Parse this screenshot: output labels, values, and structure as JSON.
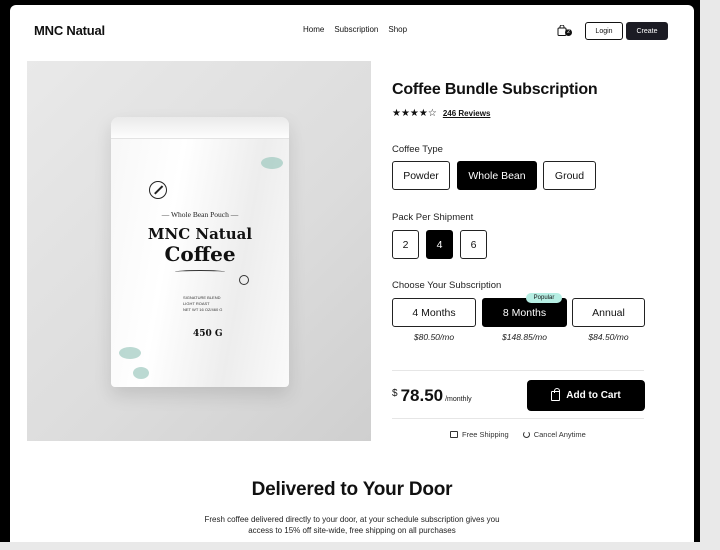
{
  "brand": "MNC Natual",
  "nav": [
    "Home",
    "Subscription",
    "Shop"
  ],
  "cart": {
    "icon": "shopping-bag-icon",
    "count": "2"
  },
  "auth": {
    "login": "Login",
    "create": "Create"
  },
  "pouch": {
    "subtitle": "— Whole Bean Pouch —",
    "brand": "MNC Natual",
    "title": "Coffee",
    "desc_lines": [
      "SIGNATURE BLEND",
      "LIGHT ROAST",
      "NET WT 16 OZ/460 G"
    ],
    "weight": "450 G"
  },
  "product": {
    "title": "Coffee Bundle Subscription",
    "stars": "★★★★☆",
    "reviews": "246 Reviews"
  },
  "coffee_type": {
    "label": "Coffee Type",
    "options": [
      "Powder",
      "Whole Bean",
      "Groud"
    ],
    "selected": "Whole Bean"
  },
  "pack": {
    "label": "Pack Per Shipment",
    "options": [
      "2",
      "4",
      "6"
    ],
    "selected": "4"
  },
  "subscription": {
    "label": "Choose Your  Subscription",
    "options": [
      "4 Months",
      "8 Months",
      "Annual"
    ],
    "prices": [
      "$80.50/mo",
      "$148.85/mo",
      "$84.50/mo"
    ],
    "selected": "8 Months",
    "popular_badge": "Popular"
  },
  "pricing": {
    "currency": "$",
    "amount": "78.50",
    "period": "/monthly"
  },
  "add_to_cart": "Add to Cart",
  "perks": [
    "Free Shipping",
    "Cancel Anytime"
  ],
  "section": {
    "headline": "Delivered to Your Door",
    "line1": "Fresh coffee delivered directly to your door, at your schedule  subscription gives you",
    "line2": "access to 15% off site-wide, free shipping on all purchases"
  },
  "colors": {
    "accent": "#000000",
    "popular": "#b6eee3",
    "create_button": "#1c1c24"
  }
}
